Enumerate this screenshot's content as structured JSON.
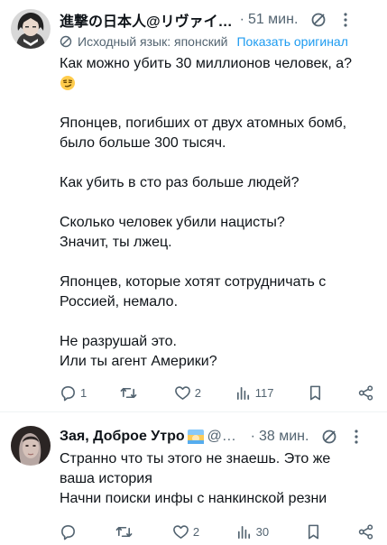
{
  "tweet1": {
    "display_name": "進撃の日本人@リヴァイ…",
    "time": "51 мин.",
    "translated_label": "Исходный язык: японский",
    "show_original": "Показать оригинал",
    "paragraphs": [
      [
        "Как можно убить 30 миллионов человек, а?"
      ],
      [
        "Японцев, погибших от двух атомных бомб,",
        "было больше 300 тысяч."
      ],
      [
        "Как убить в сто раз больше людей?"
      ],
      [
        "Сколько человек убили нацисты?",
        "Значит, ты лжец."
      ],
      [
        "Японцев, которые хотят сотрудничать с",
        "Россией, немало."
      ],
      [
        "Не разрушай это.",
        "Или ты агент Америки?"
      ]
    ],
    "reply_count": "1",
    "retweet_count": "",
    "like_count": "2",
    "views_count": "117"
  },
  "tweet2": {
    "display_name": "Зая, Доброе Утро",
    "handle": "@R…",
    "time": "38 мин.",
    "paragraphs": [
      [
        "Странно что ты этого не знаешь. Это же",
        "ваша история",
        "Начни поиски инфы с нанкинской резни"
      ]
    ],
    "reply_count": "",
    "retweet_count": "",
    "like_count": "2",
    "views_count": "30"
  },
  "icons": {
    "grok": "slash-circle-icon",
    "more": "more-vertical-icon",
    "translate": "globe-slash-icon",
    "reply": "reply-icon",
    "retweet": "retweet-icon",
    "like": "heart-icon",
    "views": "views-chart-icon",
    "bookmark": "bookmark-icon",
    "share": "share-icon"
  },
  "colors": {
    "text": "#0f1419",
    "secondary": "#536471",
    "link": "#1d9bf0"
  }
}
